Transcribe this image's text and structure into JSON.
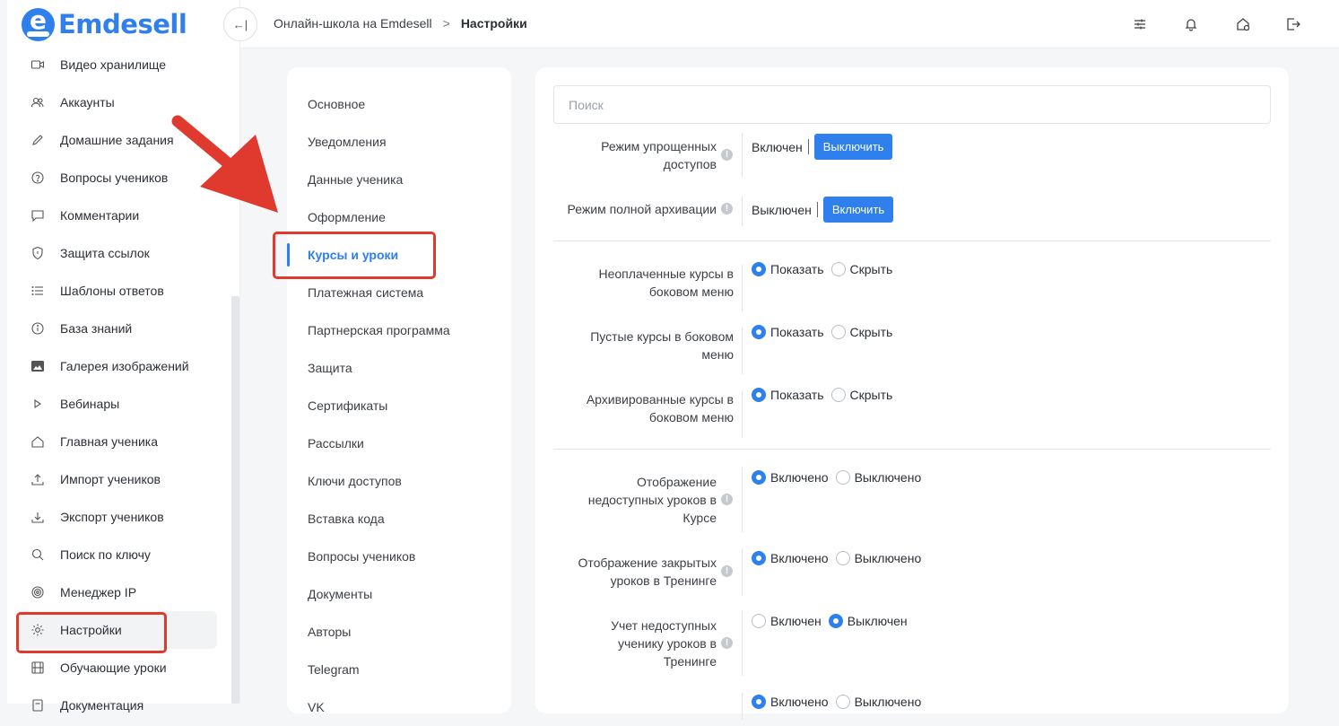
{
  "brand": {
    "name": "Emdesell",
    "logo_letter": "e"
  },
  "sidebar": {
    "items": [
      {
        "label": "Видео хранилище",
        "icon": "video-icon"
      },
      {
        "label": "Аккаунты",
        "icon": "users-icon"
      },
      {
        "label": "Домашние задания",
        "icon": "pencil-icon"
      },
      {
        "label": "Вопросы учеников",
        "icon": "question-icon"
      },
      {
        "label": "Комментарии",
        "icon": "comment-icon"
      },
      {
        "label": "Защита ссылок",
        "icon": "shield-icon"
      },
      {
        "label": "Шаблоны ответов",
        "icon": "list-icon"
      },
      {
        "label": "База знаний",
        "icon": "info-icon"
      },
      {
        "label": "Галерея изображений",
        "icon": "image-icon"
      },
      {
        "label": "Вебинары",
        "icon": "play-icon"
      },
      {
        "label": "Главная ученика",
        "icon": "home-icon"
      },
      {
        "label": "Импорт учеников",
        "icon": "upload-icon"
      },
      {
        "label": "Экспорт учеников",
        "icon": "download-icon"
      },
      {
        "label": "Поиск по ключу",
        "icon": "search-icon"
      },
      {
        "label": "Менеджер IP",
        "icon": "target-icon"
      },
      {
        "label": "Настройки",
        "icon": "gear-icon"
      },
      {
        "label": "Обучающие уроки",
        "icon": "film-icon"
      },
      {
        "label": "Документация",
        "icon": "doc-icon"
      }
    ],
    "active_index": 15
  },
  "topbar": {
    "collapse_glyph": "←|",
    "breadcrumb": {
      "root": "Онлайн-школа на Emdesell",
      "separator": ">",
      "current": "Настройки"
    },
    "icons": [
      "sliders-icon",
      "bell-icon",
      "home-settings-icon",
      "logout-icon"
    ]
  },
  "settings_menu": {
    "items": [
      "Основное",
      "Уведомления",
      "Данные ученика",
      "Оформление",
      "Курсы и уроки",
      "Платежная система",
      "Партнерская программа",
      "Защита",
      "Сертификаты",
      "Рассылки",
      "Ключи доступов",
      "Вставка кода",
      "Вопросы учеников",
      "Документы",
      "Авторы",
      "Telegram",
      "VK"
    ],
    "active_index": 4
  },
  "content": {
    "search_placeholder": "Поиск",
    "simplified_access": {
      "label_line1": "Режим упрощенных",
      "label_line2": "доступов",
      "status": "Включен",
      "button": "Выключить"
    },
    "full_archive": {
      "label": "Режим полной архивации",
      "status": "Выключен",
      "button": "Включить"
    },
    "unpaid_courses": {
      "label_line1": "Неоплаченные курсы в",
      "label_line2": "боковом меню",
      "opt_show": "Показать",
      "opt_hide": "Скрыть",
      "selected": "show"
    },
    "empty_courses": {
      "label_line1": "Пустые курсы в боковом",
      "label_line2": "меню",
      "opt_show": "Показать",
      "opt_hide": "Скрыть",
      "selected": "show"
    },
    "archived_courses": {
      "label_line1": "Архивированные курсы в",
      "label_line2": "боковом меню",
      "opt_show": "Показать",
      "opt_hide": "Скрыть",
      "selected": "show"
    },
    "unavailable_lessons_course": {
      "label_line1": "Отображение",
      "label_line2": "недоступных уроков в",
      "label_line3": "Курсе",
      "opt_on": "Включено",
      "opt_off": "Выключено",
      "selected": "on"
    },
    "closed_lessons_training": {
      "label_line1": "Отображение закрытых",
      "label_line2": "уроков в Тренинге",
      "opt_on": "Включено",
      "opt_off": "Выключено",
      "selected": "on"
    },
    "unavailable_lessons_count": {
      "label_line1": "Учет недоступных",
      "label_line2": "ученику уроков в",
      "label_line3": "Тренинге",
      "opt_on": "Включен",
      "opt_off": "Выключен",
      "selected": "off"
    },
    "last_row": {
      "opt_on": "Включено",
      "opt_off": "Выключено",
      "selected": "on"
    }
  },
  "colors": {
    "accent": "#2f80ed",
    "annotation": "#e03a2f"
  }
}
